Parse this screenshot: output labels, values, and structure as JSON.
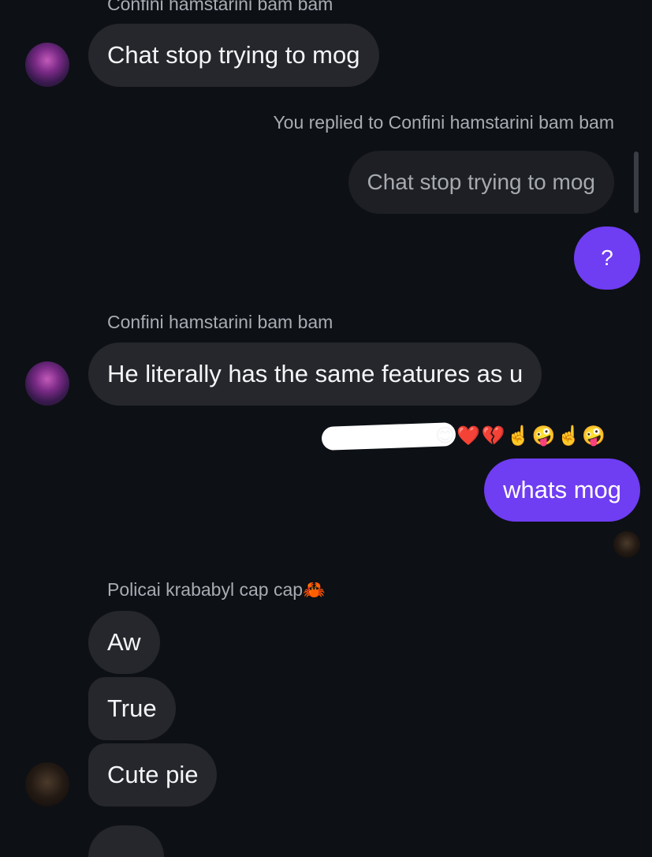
{
  "messages": {
    "top_sender_partial": "Confini hamstarini bam bam",
    "msg1": "Chat stop trying to mog",
    "reply_label": "You replied to Confini hamstarini bam bam",
    "quoted": "Chat stop trying to mog",
    "question": "?",
    "sender2": "Confini hamstarini bam bam",
    "msg2": "He literally has the same features as u",
    "reactions": "😊❤️💔☝️🤪☝️🤪",
    "my_msg": "whats mog",
    "sender3": "Policai krababyl cap cap🦀",
    "msg3": "Aw",
    "msg4": "True",
    "msg5": "Cute pie"
  },
  "icons": {
    "avatar_confini": "avatar",
    "avatar_policai": "avatar",
    "read_receipt": "avatar"
  },
  "colors": {
    "background": "#0d1015",
    "bubble_received": "#25272c",
    "bubble_sent": "#6f3df2"
  }
}
